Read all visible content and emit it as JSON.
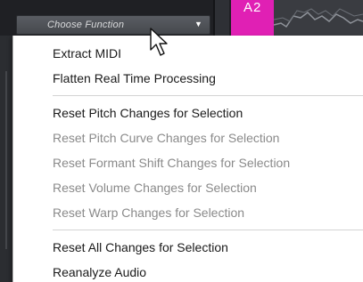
{
  "toolbar": {
    "function_select": {
      "label": "Choose Function",
      "caret": "▼"
    }
  },
  "track": {
    "clip_label": "A2",
    "clip_color": "#e020b4"
  },
  "context_menu": {
    "groups": [
      [
        {
          "label": "Extract MIDI",
          "enabled": true
        },
        {
          "label": "Flatten Real Time Processing",
          "enabled": true
        }
      ],
      [
        {
          "label": "Reset Pitch Changes for Selection",
          "enabled": true
        },
        {
          "label": "Reset Pitch Curve Changes for Selection",
          "enabled": false
        },
        {
          "label": "Reset Formant Shift Changes for Selection",
          "enabled": false
        },
        {
          "label": "Reset Volume Changes for Selection",
          "enabled": false
        },
        {
          "label": "Reset Warp Changes for Selection",
          "enabled": false
        }
      ],
      [
        {
          "label": "Reset All Changes for Selection",
          "enabled": true
        },
        {
          "label": "Reanalyze Audio",
          "enabled": true
        }
      ]
    ]
  }
}
